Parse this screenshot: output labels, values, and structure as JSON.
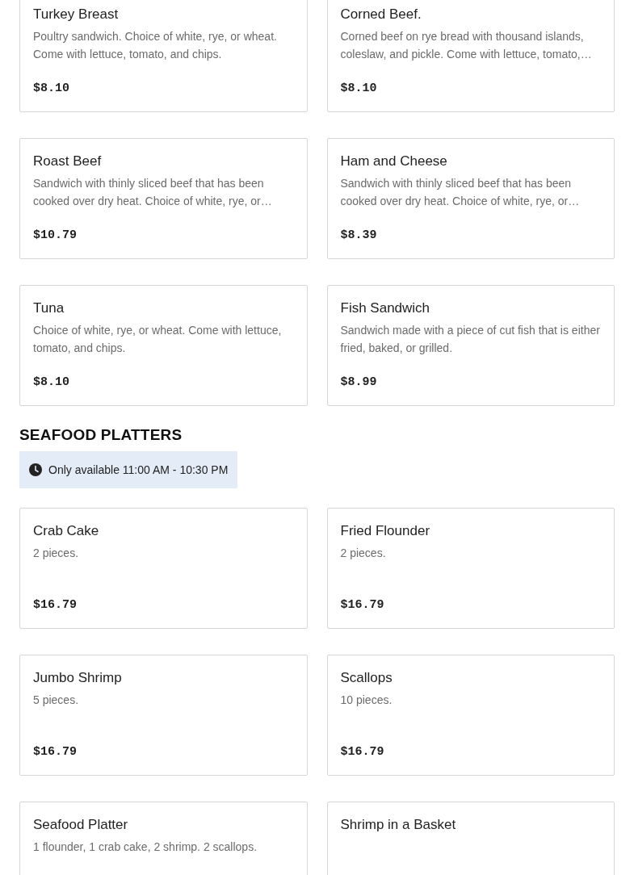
{
  "sections": [
    {
      "items": [
        {
          "name": "Turkey Breast",
          "description": "Poultry sandwich. Choice of white, rye, or wheat. Come with lettuce, tomato, and chips.",
          "price": "$8.10"
        },
        {
          "name": "Corned Beef.",
          "description": "Corned beef on rye bread with thousand islands, coleslaw, and pickle. Come with lettuce, tomato,…",
          "price": "$8.10"
        },
        {
          "name": "Roast Beef",
          "description": "Sandwich with thinly sliced beef that has been cooked over dry heat. Choice of white, rye, or…",
          "price": "$10.79"
        },
        {
          "name": "Ham and Cheese",
          "description": "Sandwich with thinly sliced beef that has been cooked over dry heat. Choice of white, rye, or…",
          "price": "$8.39"
        },
        {
          "name": "Tuna",
          "description": "Choice of white, rye, or wheat. Come with lettuce, tomato, and chips.",
          "price": "$8.10"
        },
        {
          "name": "Fish Sandwich",
          "description": "Sandwich made with a piece of cut fish that is either fried, baked, or grilled.",
          "price": "$8.99"
        }
      ]
    },
    {
      "title": "SEAFOOD PLATTERS",
      "availability": "Only available 11:00 AM - 10:30 PM",
      "items": [
        {
          "name": "Crab Cake",
          "description": "2 pieces.",
          "price": "$16.79"
        },
        {
          "name": "Fried Flounder",
          "description": "2 pieces.",
          "price": "$16.79"
        },
        {
          "name": "Jumbo Shrimp",
          "description": "5 pieces.",
          "price": "$16.79"
        },
        {
          "name": "Scallops",
          "description": "10 pieces.",
          "price": "$16.79"
        },
        {
          "name": "Seafood Platter",
          "description": "1 flounder, 1 crab cake, 2 shrimp. 2 scallops."
        },
        {
          "name": "Shrimp in a Basket"
        }
      ]
    }
  ]
}
